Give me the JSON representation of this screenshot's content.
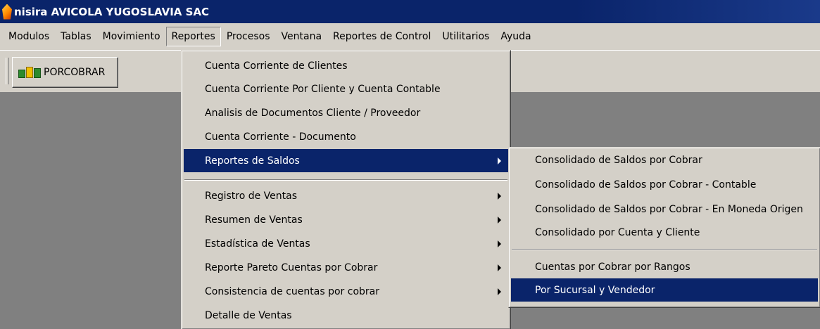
{
  "window": {
    "title": "nisira AVICOLA YUGOSLAVIA SAC",
    "icon": "app-flame-icon"
  },
  "menubar": {
    "items": [
      "Modulos",
      "Tablas",
      "Movimiento",
      "Reportes",
      "Procesos",
      "Ventana",
      "Reportes de Control",
      "Utilitarios",
      "Ayuda"
    ],
    "active": "Reportes"
  },
  "toolbar": {
    "button_label": "PORCOBRAR",
    "button_icon": "bar-chart-icon"
  },
  "reportes_menu": {
    "items": [
      "Cuenta Corriente de Clientes",
      "Cuenta Corriente Por Cliente y Cuenta Contable",
      "Analisis de Documentos Cliente / Proveedor",
      "Cuenta Corriente - Documento",
      "Reportes de Saldos",
      "Registro de Ventas",
      "Resumen de Ventas",
      "Estadística de Ventas",
      "Reporte Pareto Cuentas por Cobrar",
      "Consistencia de cuentas por cobrar",
      "Detalle de Ventas"
    ],
    "highlighted": "Reportes de Saldos"
  },
  "saldos_submenu": {
    "items": [
      "Consolidado de Saldos por Cobrar",
      "Consolidado de Saldos por Cobrar - Contable",
      "Consolidado de Saldos por Cobrar - En Moneda Origen",
      "Consolidado por Cuenta y Cliente",
      "Cuentas por Cobrar por Rangos",
      "Por Sucursal y Vendedor"
    ],
    "highlighted": "Por Sucursal y Vendedor"
  },
  "colors": {
    "titlebar": "#0a246a",
    "face": "#d4d0c8",
    "highlight": "#0a246a",
    "workspace": "#808080"
  }
}
